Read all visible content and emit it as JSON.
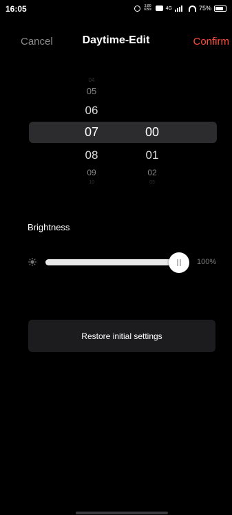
{
  "status_bar": {
    "time": "16:05",
    "speed_value": "3.80",
    "speed_unit": "KB/s",
    "network": "4G",
    "battery": "75%"
  },
  "header": {
    "cancel_label": "Cancel",
    "title": "Daytime-Edit",
    "confirm_label": "Confirm"
  },
  "picker": {
    "hours": [
      "04",
      "05",
      "06",
      "07",
      "08",
      "09",
      "10"
    ],
    "minutes": [
      "00",
      "01",
      "02",
      "03"
    ],
    "selected_hour": "07",
    "selected_minute": "00"
  },
  "brightness": {
    "label": "Brightness",
    "value": 100,
    "value_text": "100%"
  },
  "restore_label": "Restore initial settings",
  "colors": {
    "accent": "#ff4d3d",
    "background": "#000000",
    "button_bg": "#1c1c1e",
    "highlight": "#2c2c2e"
  }
}
